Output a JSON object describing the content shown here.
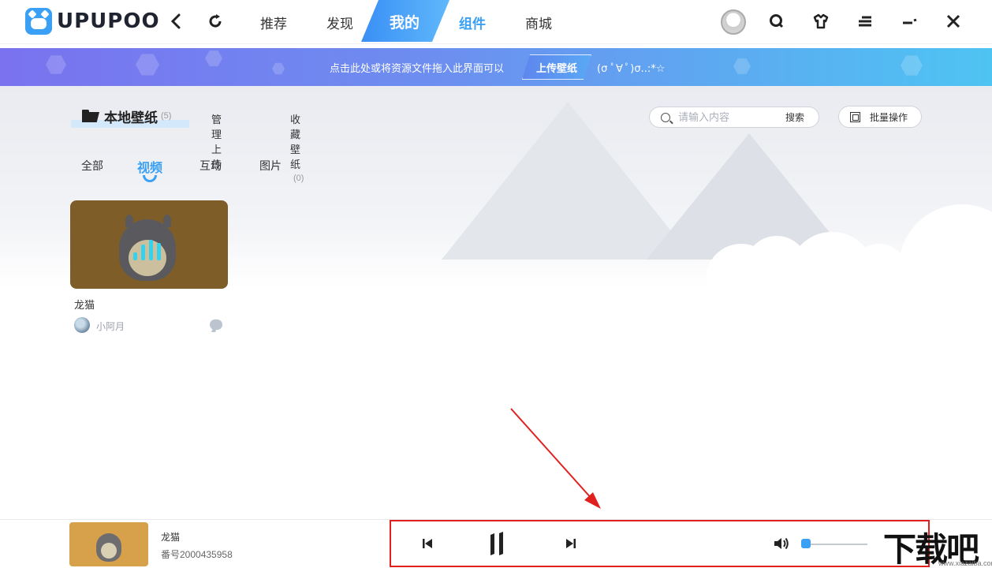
{
  "app": {
    "logo_text": "UPUPOO"
  },
  "topbar": {
    "tabs": [
      {
        "label": "推荐"
      },
      {
        "label": "发现"
      },
      {
        "label": "我的"
      },
      {
        "label": "组件"
      },
      {
        "label": "商城"
      }
    ],
    "active_tab": "我的"
  },
  "banner": {
    "text": "点击此处或将资源文件拖入此界面可以",
    "button": "上传壁纸",
    "emote": "(σ ﾟ∀ ﾟ)σ..:*☆"
  },
  "section": {
    "main_label": "本地壁纸",
    "main_count": "(5)",
    "tab_manage": "管理上传",
    "tab_fav": "收藏壁纸",
    "tab_fav_count": "(0)"
  },
  "search": {
    "placeholder": "请输入内容",
    "button": "搜索"
  },
  "batch": {
    "label": "批量操作"
  },
  "filters": [
    {
      "label": "全部"
    },
    {
      "label": "视频"
    },
    {
      "label": "互动"
    },
    {
      "label": "图片"
    }
  ],
  "active_filter": "视频",
  "card": {
    "title": "龙猫",
    "author": "小阿月"
  },
  "player": {
    "title": "龙猫",
    "id_text": "番号2000435958",
    "volume": 0.05
  },
  "watermark": {
    "text": "下载吧",
    "url": "www.xiazaiba.com"
  },
  "colors": {
    "accent": "#3aa0f5",
    "annotation": "#e0201f"
  }
}
